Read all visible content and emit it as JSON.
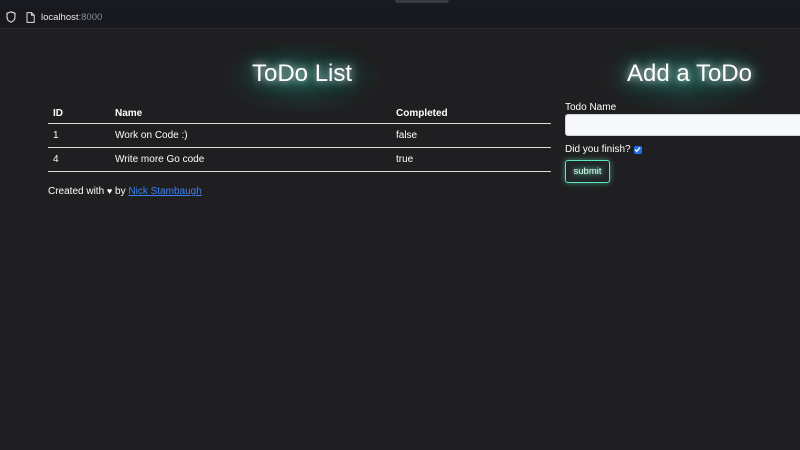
{
  "browser": {
    "url_host": "localhost",
    "url_port": ":8000"
  },
  "todo_list": {
    "title": "ToDo List",
    "columns": [
      "ID",
      "Name",
      "Completed"
    ],
    "rows": [
      {
        "id": "1",
        "name": "Work on Code :)",
        "completed": "false"
      },
      {
        "id": "4",
        "name": "Write more Go code",
        "completed": "true"
      }
    ]
  },
  "footer": {
    "prefix": "Created with",
    "heart": "♥",
    "by": "by",
    "author_link": "Nick Stambaugh"
  },
  "add_form": {
    "title": "Add a ToDo",
    "name_label": "Todo Name",
    "name_value": "",
    "finish_label": "Did you finish?",
    "finish_checked": true,
    "submit_label": "submit"
  },
  "colors": {
    "background": "#1f1f21",
    "glow": "#50e6c8",
    "submit_border": "#5fe3b4",
    "link": "#3b82f6",
    "checkbox": "#1e6fe8"
  }
}
